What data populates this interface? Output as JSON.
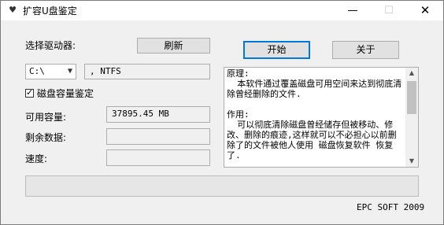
{
  "window": {
    "title": "扩容U盘鉴定",
    "app_icon": "heart-icon"
  },
  "controls": {
    "select_drive_label": "选择驱动器:",
    "refresh_button": "刷新",
    "start_button": "开始",
    "about_button": "关于",
    "drive_select_value": "C:\\",
    "filesystem_value": ", NTFS",
    "check_label": "磁盘容量鉴定",
    "check_checked": true,
    "available_label": "可用容量:",
    "available_value": "37895.45 MB",
    "remaining_label": "剩余数据:",
    "remaining_value": "",
    "speed_label": "速度:",
    "speed_value": ""
  },
  "info_text": "原理:\n  本软件通过覆盖磁盘可用空间来达到彻底清除曾经删除的文件.\n\n作用:\n  可以彻底清除磁盘曾经储存但被移动、修改、删除的痕迹,这样就可以不必担心以前删除了的文件被他人使用 磁盘恢复软件 恢复了.",
  "progress": {
    "value": 0
  },
  "footer": "EPC SOFT 2009",
  "colors": {
    "accent": "#0078d7",
    "progress": "#06b025"
  }
}
